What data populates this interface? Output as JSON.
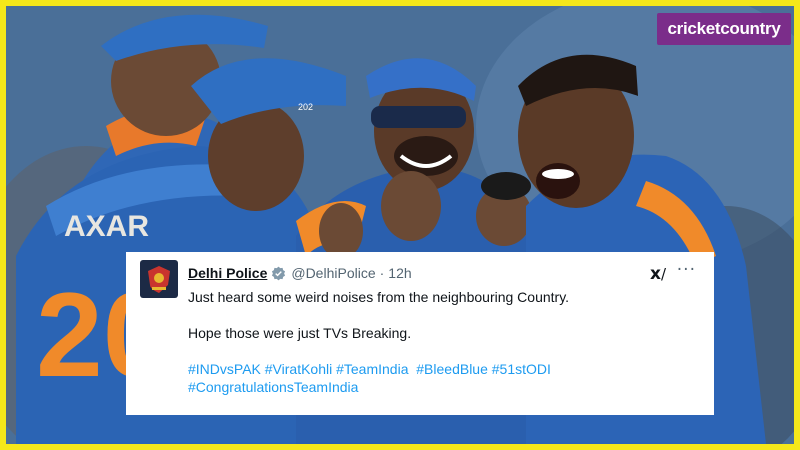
{
  "brand": {
    "text": "cricketcountry",
    "bg": "#7b2d8a"
  },
  "jersey": {
    "name": "AXAR",
    "number": "20",
    "cap_number": "202"
  },
  "tweet": {
    "name": "Delhi Police",
    "handle": "@DelhiPolice",
    "separator": "·",
    "time": "12h",
    "grok_label": "x",
    "more_label": "···",
    "line1": "Just heard some weird noises from the neighbouring Country.",
    "line2": "Hope those were just TVs Breaking.",
    "hashtags1": "#INDvsPAK #ViratKohli #TeamIndia  #BleedBlue #51stODI",
    "hashtags2": "#CongratulationsTeamIndia",
    "verified_icon": "verified-badge-icon",
    "link_color": "#1d9bf0"
  },
  "frame_color": "#f5e71a"
}
